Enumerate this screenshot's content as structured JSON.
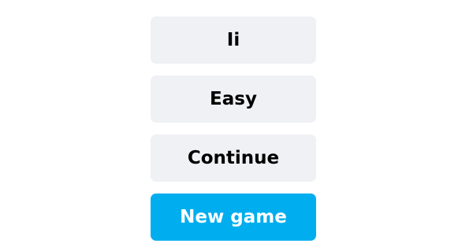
{
  "menu": {
    "buttons": [
      {
        "label": "Ii"
      },
      {
        "label": "Easy"
      },
      {
        "label": "Continue"
      },
      {
        "label": "New game"
      }
    ]
  },
  "colors": {
    "button_bg": "#f0f1f4",
    "primary_bg": "#00aeef",
    "primary_text": "#ffffff",
    "text": "#000000"
  }
}
